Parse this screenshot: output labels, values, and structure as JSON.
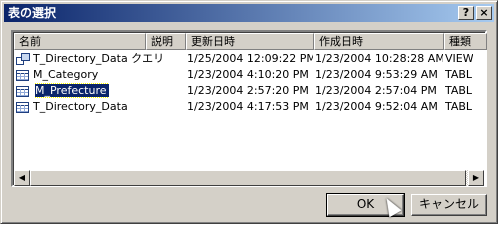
{
  "window": {
    "title": "表の選択",
    "help_label": "?",
    "close_label": "×"
  },
  "columns": [
    "名前",
    "説明",
    "更新日時",
    "作成日時",
    "種類"
  ],
  "rows": [
    {
      "name": "T_Directory_Data クエリ",
      "description": "",
      "updated": "1/25/2004 12:09:22 PM",
      "created": "1/23/2004 10:28:28 AM",
      "type": "VIEW",
      "icon": "query-icon"
    },
    {
      "name": "M_Category",
      "description": "",
      "updated": "1/23/2004 4:10:20 PM",
      "created": "1/23/2004 9:53:29 AM",
      "type": "TABLE",
      "icon": "table-icon"
    },
    {
      "name": "M_Prefecture",
      "description": "",
      "updated": "1/23/2004 2:57:20 PM",
      "created": "1/23/2004 2:57:04 PM",
      "type": "TABLE",
      "icon": "table-icon",
      "selected": true
    },
    {
      "name": "T_Directory_Data",
      "description": "",
      "updated": "1/23/2004 4:17:53 PM",
      "created": "1/23/2004 9:52:04 AM",
      "type": "TABLE",
      "icon": "table-icon"
    }
  ],
  "buttons": {
    "ok": "OK",
    "cancel": "キャンセル"
  },
  "scrollbar": {
    "left_arrow": "◀",
    "right_arrow": "▶"
  },
  "colors": {
    "selection": "#0a246a",
    "titlebar": "#0a246a",
    "face": "#d4d0c8"
  }
}
